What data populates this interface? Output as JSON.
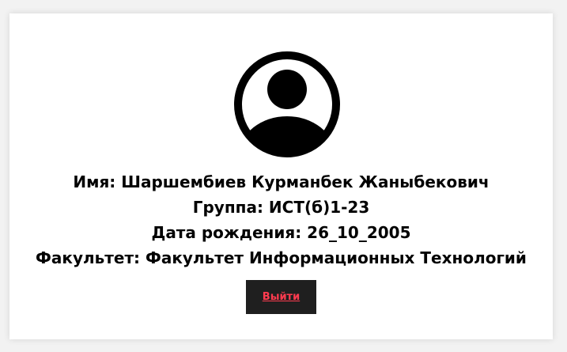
{
  "profile": {
    "avatar_icon": "user-circle-icon",
    "name_line": "Имя: Шаршембиев Курманбек Жаныбекович",
    "group_line": "Группа: ИСТ(б)1-23",
    "birthdate_line": "Дата рождения: 26_10_2005",
    "faculty_line": "Факультет: Факультет Информационных Технологий"
  },
  "actions": {
    "logout_label": "Выйти"
  },
  "colors": {
    "page_background": "#f2f2f2",
    "card_background": "#ffffff",
    "button_background": "#1f1f1f",
    "button_text": "#ff3b4f"
  }
}
